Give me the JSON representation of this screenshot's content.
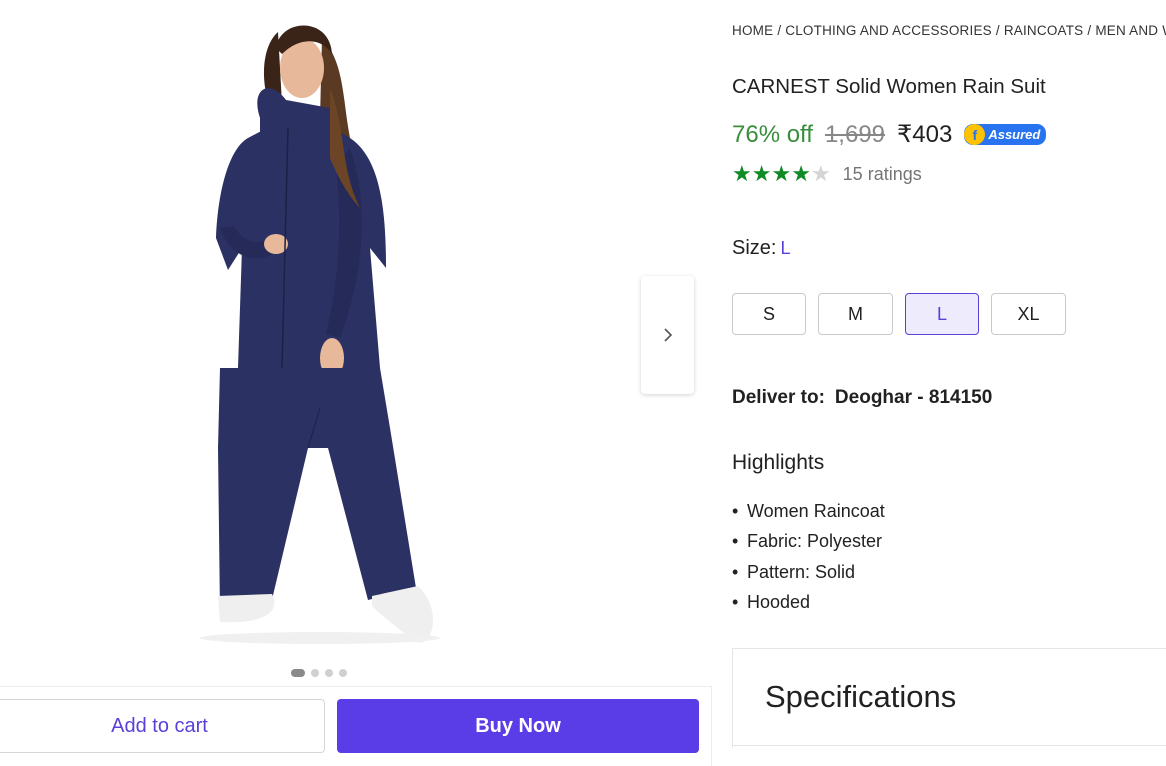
{
  "gallery": {
    "next_icon": "chevron-right-icon",
    "dots_count": 4,
    "active_dot": 0
  },
  "actions": {
    "add_to_cart": "Add to cart",
    "buy_now": "Buy Now"
  },
  "breadcrumb": {
    "items": [
      "HOME",
      "CLOTHING AND ACCESSORIES",
      "RAINCOATS",
      "MEN AND WO"
    ],
    "separator": "/"
  },
  "product": {
    "title": "CARNEST Solid Women Rain Suit",
    "discount": "76% off",
    "mrp": "1,699",
    "price": "₹403",
    "assured_label": "Assured",
    "rating_stars": 4,
    "rating_max": 5,
    "ratings_text": "15 ratings"
  },
  "size": {
    "label": "Size:",
    "selected": "L",
    "options": [
      "S",
      "M",
      "L",
      "XL"
    ]
  },
  "delivery": {
    "label": "Deliver to:",
    "location": "Deoghar - 814150"
  },
  "highlights": {
    "title": "Highlights",
    "items": [
      "Women Raincoat",
      "Fabric: Polyester",
      "Pattern: Solid",
      "Hooded"
    ]
  },
  "specifications": {
    "title": "Specifications"
  },
  "colors": {
    "accent": "#5a3de6",
    "discount_green": "#388e3c",
    "star_green": "#0f8a24",
    "suit_navy": "#2b3163"
  }
}
